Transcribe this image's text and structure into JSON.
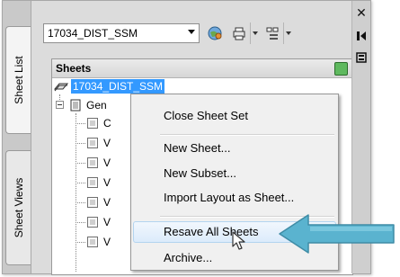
{
  "tabs": {
    "sheet_list": "Sheet List",
    "sheet_views": "Sheet Views"
  },
  "toolbar": {
    "sheet_set_combo": "17034_DIST_SSM"
  },
  "tree": {
    "header": "Sheets",
    "root": "17034_DIST_SSM",
    "subset_partial": "Gen",
    "items_partial": [
      "C",
      "V",
      "V",
      "V",
      "V",
      "V",
      "V"
    ]
  },
  "context_menu": {
    "items": [
      "Close Sheet Set",
      "New Sheet...",
      "New Subset...",
      "Import Layout as Sheet...",
      "Resave All Sheets",
      "Archive..."
    ],
    "highlighted": "Resave All Sheets"
  },
  "colors": {
    "selection": "#3399ff",
    "callout_arrow": "#5ab3cf",
    "menu_highlight": "#dcebfb"
  }
}
